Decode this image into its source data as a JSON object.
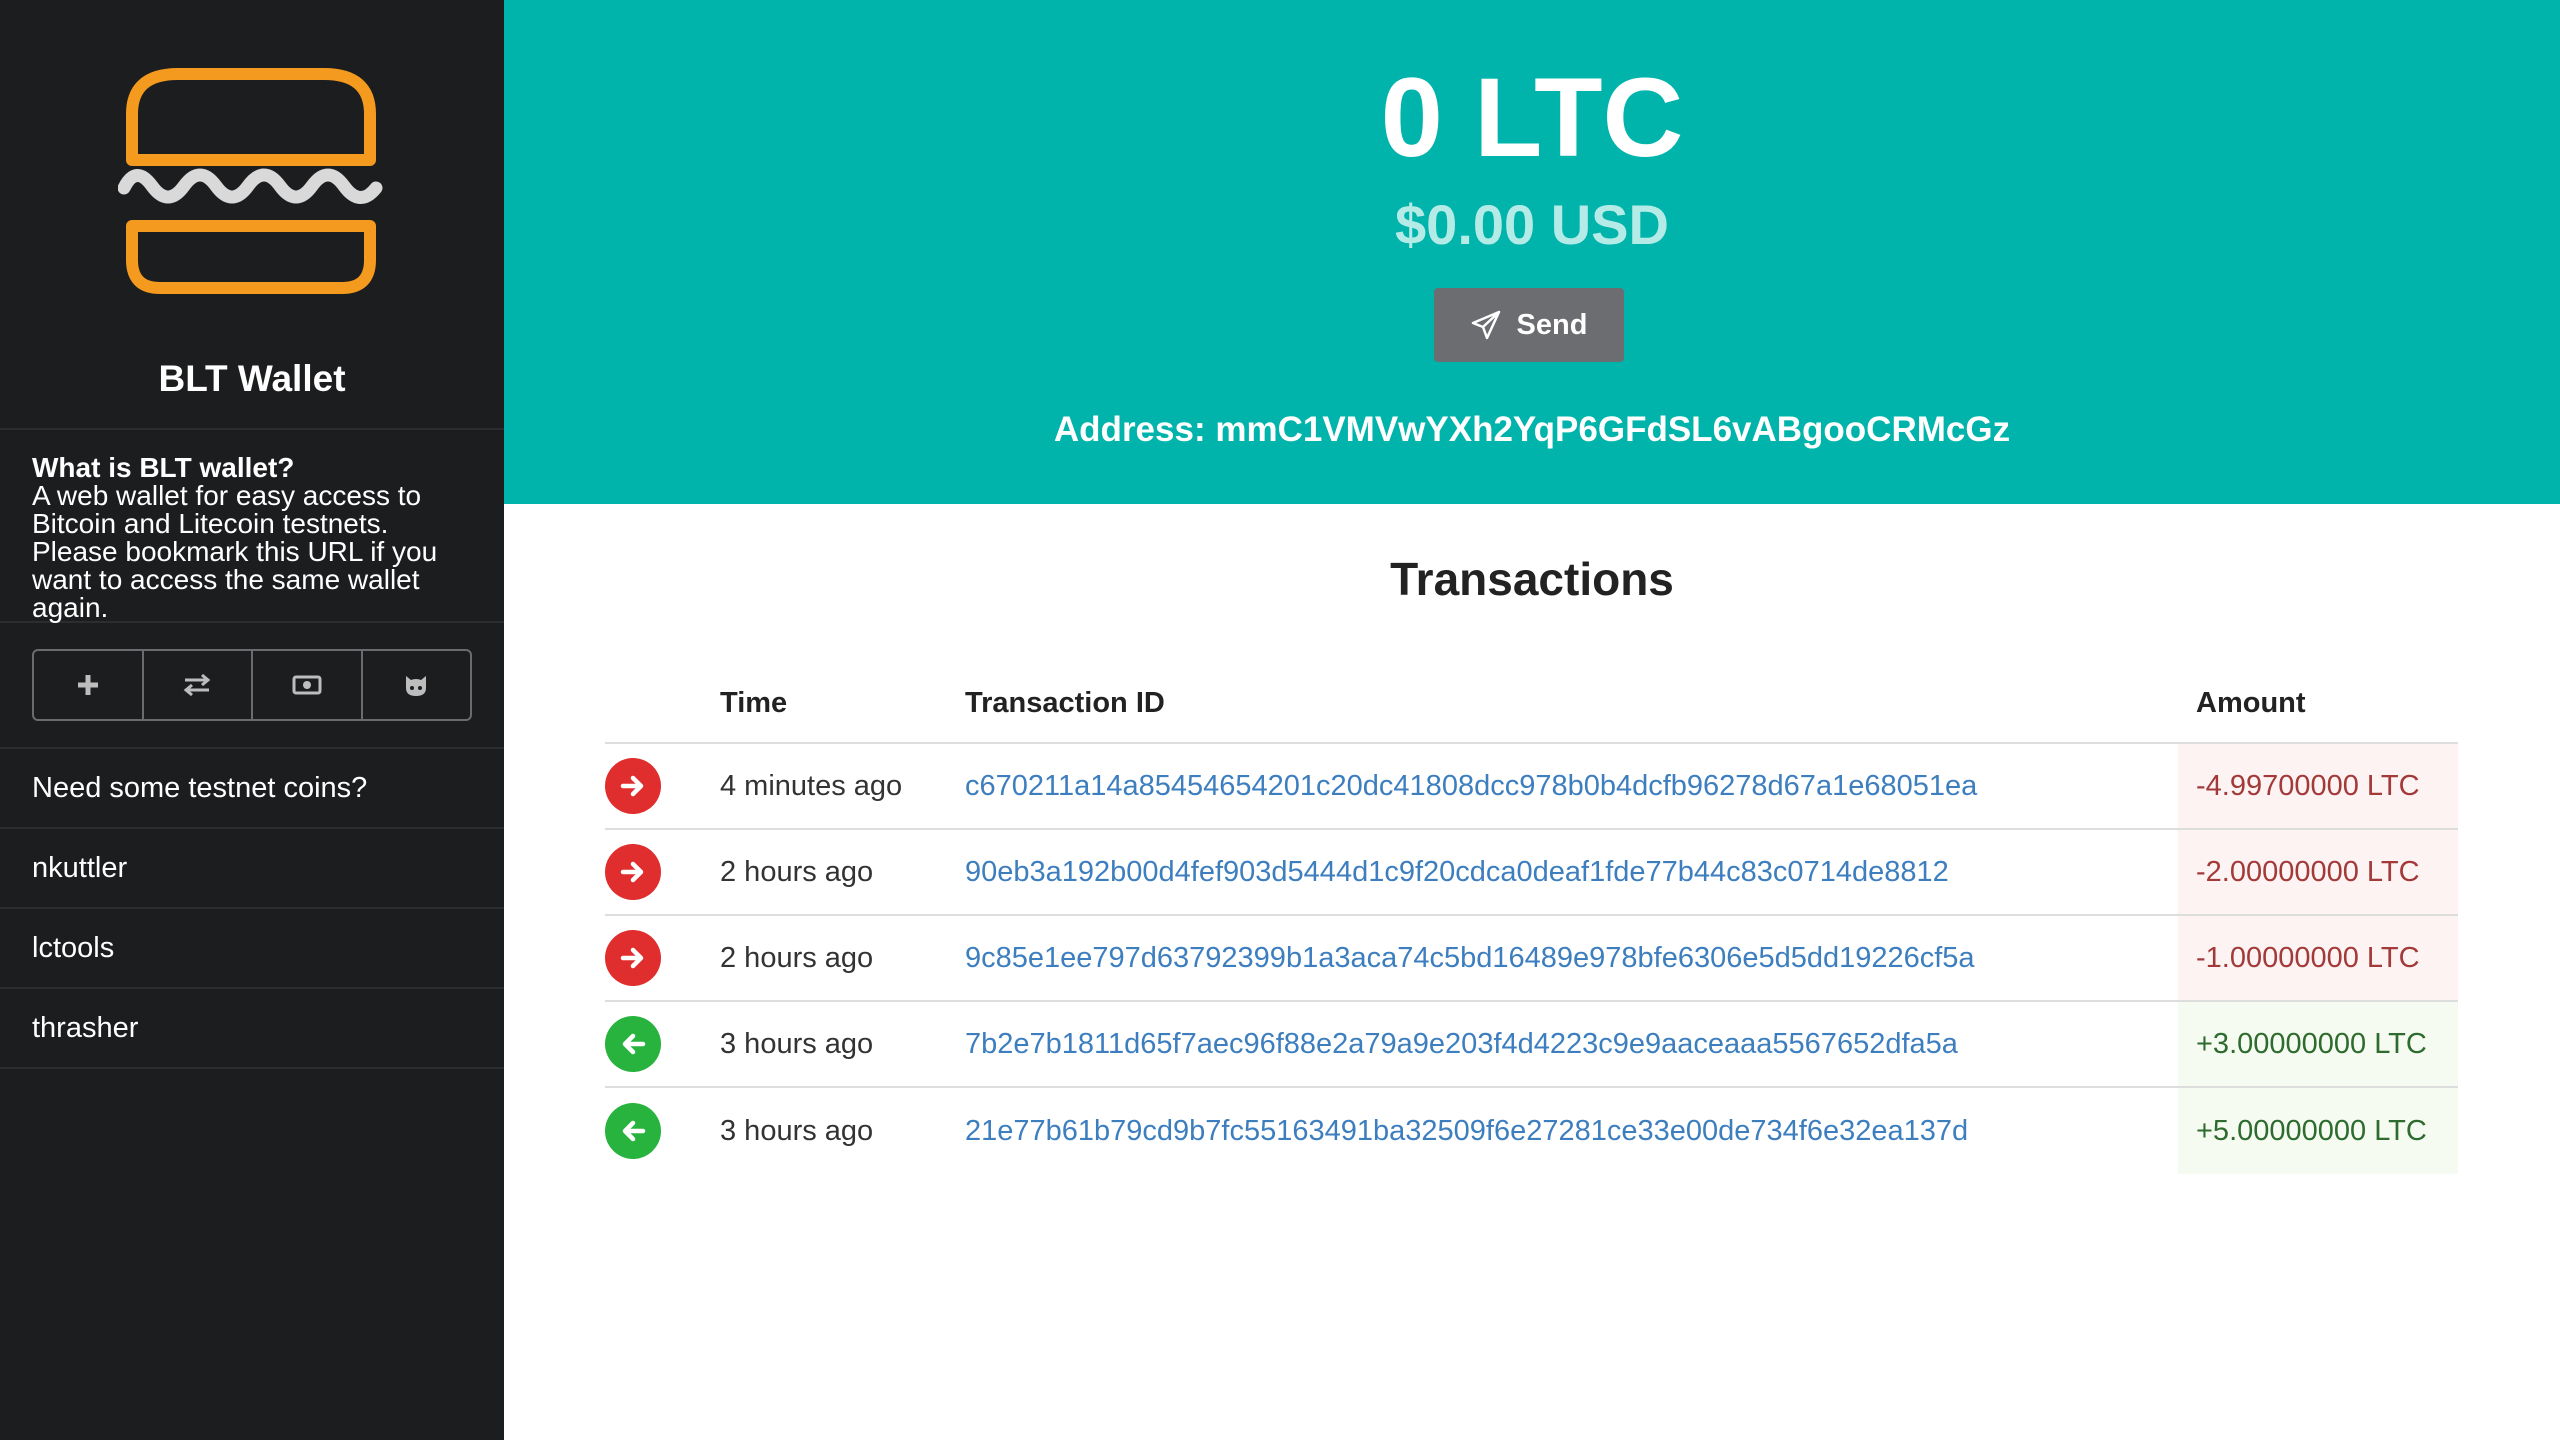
{
  "app": {
    "brand": "BLT Wallet",
    "logo_icon": "hamburger-logo-icon",
    "accent_color": "#f39a1f"
  },
  "sidebar": {
    "about_title": "What is BLT wallet?",
    "about_text": "A web wallet for easy access to Bitcoin and Litecoin testnets. Please bookmark this URL if you want to access the same wallet again.",
    "toolbar": [
      {
        "icon": "plus-icon"
      },
      {
        "icon": "swap-arrows-icon"
      },
      {
        "icon": "money-icon"
      },
      {
        "icon": "github-icon"
      }
    ],
    "links": [
      {
        "label": "Need some testnet coins?"
      },
      {
        "label": "nkuttler"
      },
      {
        "label": "lctools"
      },
      {
        "label": "thrasher"
      }
    ]
  },
  "header": {
    "balance": "0 LTC",
    "usd": "$0.00 USD",
    "send_label": "Send",
    "send_icon": "paper-plane-icon",
    "address": "Address: mmC1VMVwYXh2YqP6GFdSL6vABgooCRMcGz",
    "bg_color": "#00b4ac"
  },
  "transactions": {
    "title": "Transactions",
    "columns": {
      "time": "Time",
      "id": "Transaction ID",
      "amount": "Amount"
    },
    "rows": [
      {
        "direction": "out",
        "time": "4 minutes ago",
        "id": "c670211a14a85454654201c20dc41808dcc978b0b4dcfb96278d67a1e68051ea",
        "amount": "-4.99700000 LTC"
      },
      {
        "direction": "out",
        "time": "2 hours ago",
        "id": "90eb3a192b00d4fef903d5444d1c9f20cdca0deaf1fde77b44c83c0714de8812",
        "amount": "-2.00000000 LTC"
      },
      {
        "direction": "out",
        "time": "2 hours ago",
        "id": "9c85e1ee797d63792399b1a3aca74c5bd16489e978bfe6306e5d5dd19226cf5a",
        "amount": "-1.00000000 LTC"
      },
      {
        "direction": "in",
        "time": "3 hours ago",
        "id": "7b2e7b1811d65f7aec96f88e2a79a9e203f4d4223c9e9aaceaaa5567652dfa5a",
        "amount": "+3.00000000 LTC"
      },
      {
        "direction": "in",
        "time": "3 hours ago",
        "id": "21e77b61b79cd9b7fc55163491ba32509f6e27281ce33e00de734f6e32ea137d",
        "amount": "+5.00000000 LTC"
      }
    ]
  }
}
